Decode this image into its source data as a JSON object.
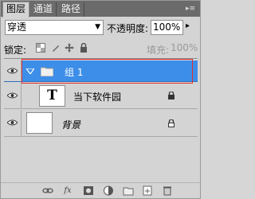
{
  "tabs": [
    {
      "label": "图层",
      "active": true
    },
    {
      "label": "通道",
      "active": false
    },
    {
      "label": "路径",
      "active": false
    }
  ],
  "blend": {
    "mode": "穿透",
    "opacity_label": "不透明度:",
    "opacity_value": "100%"
  },
  "lock": {
    "label": "锁定:",
    "fill_label": "填充:",
    "fill_value": "100%"
  },
  "layers": [
    {
      "name": "组 1",
      "type": "group",
      "selected": true
    },
    {
      "name": "当下软件园",
      "type": "text",
      "thumb_glyph": "T",
      "locked": true
    },
    {
      "name": "背景",
      "type": "background",
      "locked": true
    }
  ],
  "colors": {
    "selection": "#3d8ee8",
    "highlight_box": "#e03030",
    "tab_bar": "#6b6b6b"
  },
  "toolbar_icons": [
    "link-icon",
    "fx-icon",
    "mask-icon",
    "adjustment-icon",
    "folder-icon",
    "new-layer-icon",
    "trash-icon"
  ]
}
